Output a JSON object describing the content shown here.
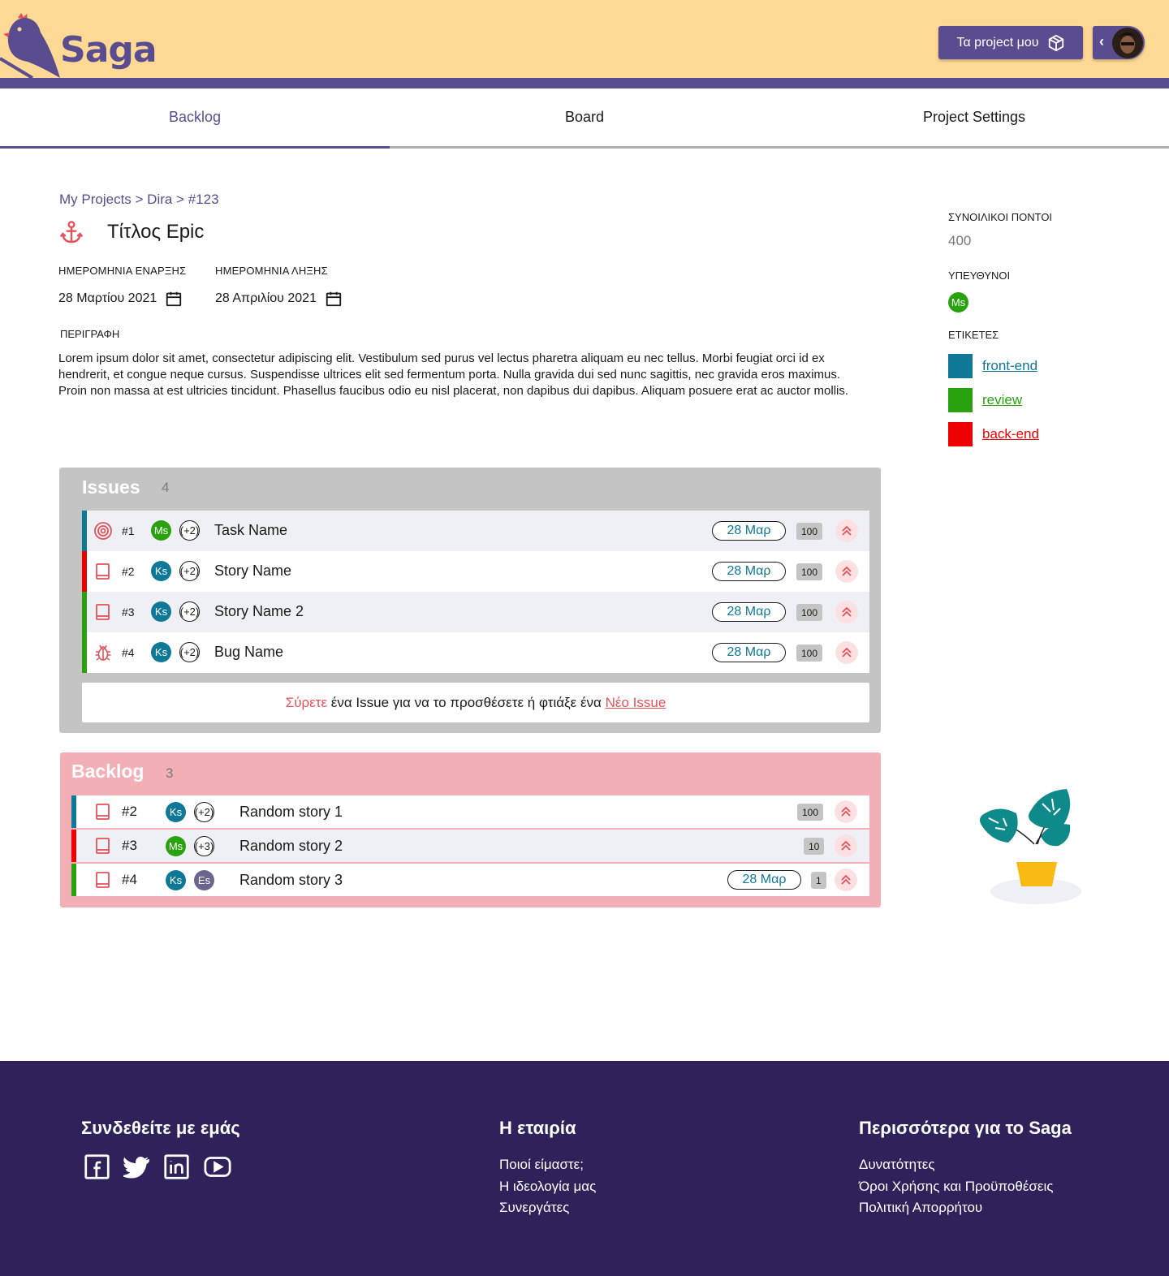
{
  "header": {
    "logo_text": "Saga",
    "projects_button": "Τα project μου"
  },
  "tabs": [
    "Backlog",
    "Board",
    "Project Settings"
  ],
  "breadcrumb": "My Projects > Dira > #123",
  "epic": {
    "title": "Τίτλος Epic",
    "start_label": "ΗΜΕΡΟΜΗΝΙΑ ΕΝΑΡΞΗΣ",
    "start_value": "28 Μαρτίου 2021",
    "end_label": "ΗΜΕΡΟΜΗΝΙΑ ΛΗΞΗΣ",
    "end_value": "28 Απριλίου 2021",
    "description_label": "ΠΕΡΙΓΡΑΦΗ",
    "description": "Lorem ipsum dolor sit amet, consectetur adipiscing elit. Vestibulum sed purus vel lectus pharetra aliquam eu nec tellus. Morbi feugiat orci id ex hendrerit, et congue neque cursus. Suspendisse ultrices elit sed fermentum porta. Nulla gravida dui sed nunc sagittis, nec gravida eros maximus. Proin non massa at est ultricies tincidunt. Phasellus faucibus odio eu nisl placerat, non dapibus dui dapibus. Aliquam posuere erat ac auctor mollis."
  },
  "sidebar": {
    "points_label": "ΣΥΝΟΙΛΙΚΟΙ ΠΟΝΤΟΙ",
    "points_value": "400",
    "assignees_label": "ΥΠΕΥΘΥΝΟΙ",
    "assignee": "Ms",
    "tags_label": "ΕΤΙΚΕΤΕΣ",
    "tags": [
      {
        "label": "front-end",
        "color": "#0e7896"
      },
      {
        "label": "review",
        "color": "#2aa10f"
      },
      {
        "label": "back-end",
        "color": "#ee0000"
      }
    ]
  },
  "issues": {
    "title": "Issues",
    "count": "4",
    "rows": [
      {
        "num": "#1",
        "avatar": "Ms",
        "extra": "+2",
        "name": "Task Name",
        "date": "28 Μαρ",
        "points": "100"
      },
      {
        "num": "#2",
        "avatar": "Ks",
        "extra": "+2",
        "name": "Story Name",
        "date": "28 Μαρ",
        "points": "100"
      },
      {
        "num": "#3",
        "avatar": "Ks",
        "extra": "+2",
        "name": "Story Name 2",
        "date": "28 Μαρ",
        "points": "100"
      },
      {
        "num": "#4",
        "avatar": "Ks",
        "extra": "+2",
        "name": "Bug Name",
        "date": "28 Μαρ",
        "points": "100"
      }
    ],
    "dropzone_drag": "Σύρετε",
    "dropzone_middle": " ένα Issue για να το προσθέσετε ή φτιάξε ένα ",
    "dropzone_link": "Νέο Issue"
  },
  "backlog": {
    "title": "Backlog",
    "count": "3",
    "rows": [
      {
        "num": "#2",
        "avatar": "Ks",
        "extra": "+2",
        "name": "Random story 1",
        "points": "100"
      },
      {
        "num": "#3",
        "avatar": "Ms",
        "extra": "+3",
        "name": "Random story 2",
        "points": "10"
      },
      {
        "num": "#4",
        "avatar": "Ks",
        "avatar2": "Es",
        "name": "Random story 3",
        "date": "28 Μαρ",
        "points": "1"
      }
    ]
  },
  "footer": {
    "col1_title": "Συνδεθείτε με εμάς",
    "col2_title": "Η εταιρία",
    "col2_links": [
      "Ποιοί είμαστε;",
      "Η ιδεολογία μας",
      "Συνεργάτες"
    ],
    "col3_title": "Περισσότερα για το Saga",
    "col3_links": [
      "Δυνατότητες",
      "Όροι Χρήσης και Προϋποθέσεις",
      "Πολιτική Απορρήτου"
    ]
  },
  "colors": {
    "brand": "#5a4d8f",
    "header_bg": "#fed995",
    "teal": "#0e7896",
    "green": "#2aa10f",
    "red": "#ee0000",
    "footer_bg": "#30215a"
  }
}
